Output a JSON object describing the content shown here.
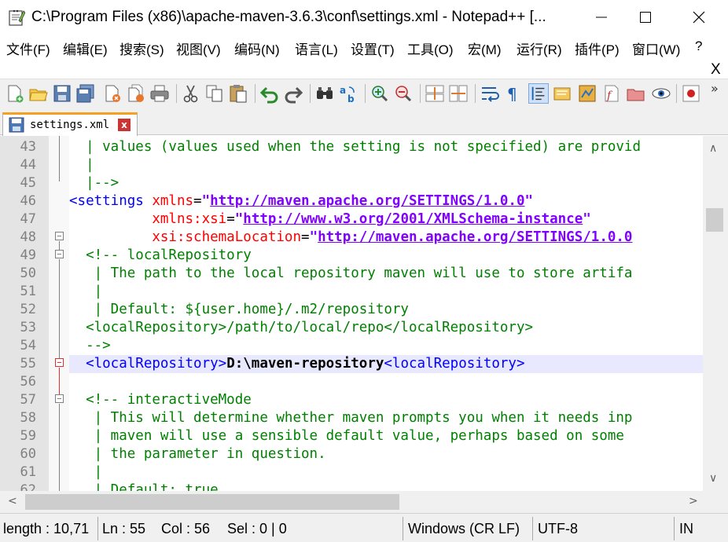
{
  "window": {
    "title": "C:\\Program Files (x86)\\apache-maven-3.6.3\\conf\\settings.xml - Notepad++ [..."
  },
  "menu": {
    "items": [
      "文件(F)",
      "编辑(E)",
      "搜索(S)",
      "视图(V)",
      "编码(N)",
      "语言(L)",
      "设置(T)",
      "工具(O)",
      "宏(M)",
      "运行(R)",
      "插件(P)",
      "窗口(W)",
      "?"
    ],
    "close_label": "X"
  },
  "toolbar": {
    "icons": [
      "new-file-icon",
      "open-file-icon",
      "save-icon",
      "save-all-icon",
      "close-icon",
      "close-all-icon",
      "print-icon",
      "cut-icon",
      "copy-icon",
      "paste-icon",
      "undo-icon",
      "redo-icon",
      "find-icon",
      "replace-icon",
      "zoom-in-icon",
      "zoom-out-icon",
      "sync-vertical-icon",
      "sync-horizontal-icon",
      "word-wrap-icon",
      "show-all-chars-icon",
      "indent-guide-icon",
      "udl-icon",
      "doc-map-icon",
      "function-list-icon",
      "folder-workspace-icon",
      "monitor-icon",
      "record-macro-icon"
    ],
    "more": "»"
  },
  "tab": {
    "label": "settings.xml",
    "close": "x"
  },
  "editor": {
    "lines": [
      {
        "num": "43",
        "segments": [
          {
            "cls": "c-comment",
            "text": "  | values (values used when the setting is not specified) are provid"
          }
        ]
      },
      {
        "num": "44",
        "segments": [
          {
            "cls": "c-comment",
            "text": "  |"
          }
        ]
      },
      {
        "num": "45",
        "segments": [
          {
            "cls": "c-comment",
            "text": "  |-->"
          }
        ]
      },
      {
        "num": "46",
        "segments": [
          {
            "cls": "c-tag",
            "text": "<settings "
          },
          {
            "cls": "c-attr",
            "text": "xmlns"
          },
          {
            "cls": "c-text",
            "text": "="
          },
          {
            "cls": "c-str",
            "text": "\""
          },
          {
            "cls": "c-url",
            "text": "http://maven.apache.org/SETTINGS/1.0.0"
          },
          {
            "cls": "c-str",
            "text": "\""
          }
        ]
      },
      {
        "num": "47",
        "segments": [
          {
            "cls": "c-text",
            "text": "          "
          },
          {
            "cls": "c-attr",
            "text": "xmlns:xsi"
          },
          {
            "cls": "c-text",
            "text": "="
          },
          {
            "cls": "c-str",
            "text": "\""
          },
          {
            "cls": "c-url",
            "text": "http://www.w3.org/2001/XMLSchema-instance"
          },
          {
            "cls": "c-str",
            "text": "\""
          }
        ]
      },
      {
        "num": "48",
        "segments": [
          {
            "cls": "c-text",
            "text": "          "
          },
          {
            "cls": "c-attr",
            "text": "xsi:schemaLocation"
          },
          {
            "cls": "c-text",
            "text": "="
          },
          {
            "cls": "c-str",
            "text": "\""
          },
          {
            "cls": "c-url",
            "text": "http://maven.apache.org/SETTINGS/1.0.0"
          }
        ]
      },
      {
        "num": "49",
        "segments": [
          {
            "cls": "c-comment",
            "text": "  <!-- localRepository"
          }
        ]
      },
      {
        "num": "50",
        "segments": [
          {
            "cls": "c-comment",
            "text": "   | The path to the local repository maven will use to store artifa"
          }
        ]
      },
      {
        "num": "51",
        "segments": [
          {
            "cls": "c-comment",
            "text": "   |"
          }
        ]
      },
      {
        "num": "52",
        "segments": [
          {
            "cls": "c-comment",
            "text": "   | Default: ${user.home}/.m2/repository"
          }
        ]
      },
      {
        "num": "53",
        "segments": [
          {
            "cls": "c-comment",
            "text": "  <localRepository>/path/to/local/repo</localRepository>"
          }
        ]
      },
      {
        "num": "54",
        "segments": [
          {
            "cls": "c-comment",
            "text": "  -->"
          }
        ]
      },
      {
        "num": "55",
        "segments": [
          {
            "cls": "c-text",
            "text": "  "
          },
          {
            "cls": "c-tag",
            "text": "<localRepository>"
          },
          {
            "cls": "c-bold",
            "text": "D:\\maven-repository"
          },
          {
            "cls": "c-tag",
            "text": "<localRepository>"
          }
        ]
      },
      {
        "num": "56",
        "segments": []
      },
      {
        "num": "57",
        "segments": [
          {
            "cls": "c-comment",
            "text": "  <!-- interactiveMode"
          }
        ]
      },
      {
        "num": "58",
        "segments": [
          {
            "cls": "c-comment",
            "text": "   | This will determine whether maven prompts you when it needs inp"
          }
        ]
      },
      {
        "num": "59",
        "segments": [
          {
            "cls": "c-comment",
            "text": "   | maven will use a sensible default value, perhaps based on some"
          }
        ]
      },
      {
        "num": "60",
        "segments": [
          {
            "cls": "c-comment",
            "text": "   | the parameter in question."
          }
        ]
      },
      {
        "num": "61",
        "segments": [
          {
            "cls": "c-comment",
            "text": "   |"
          }
        ]
      },
      {
        "num": "62",
        "segments": [
          {
            "cls": "c-comment",
            "text": "   | Default: true"
          }
        ]
      }
    ],
    "current_line": "55"
  },
  "status": {
    "length": "length : 10,71",
    "ln": "Ln : 55",
    "col": "Col : 56",
    "sel": "Sel : 0 | 0",
    "eol": "Windows (CR LF)",
    "encoding": "UTF-8",
    "mode": "IN"
  },
  "colors": {
    "comment": "#008000",
    "tag": "#0000ff",
    "attr": "#ff0000",
    "string": "#8000ff",
    "current_line_bg": "#e8e8ff",
    "tab_accent": "#f6a020"
  }
}
